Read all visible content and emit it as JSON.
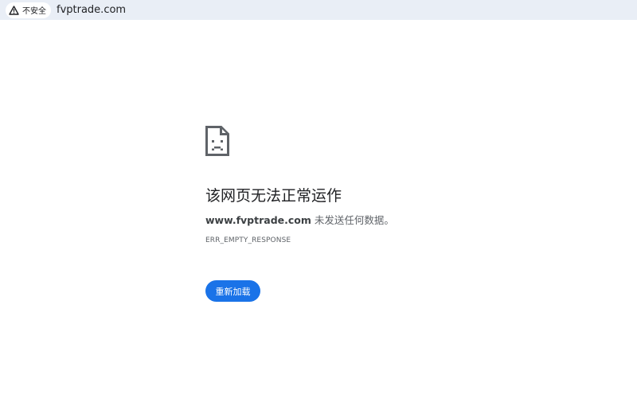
{
  "address_bar": {
    "security_label": "不安全",
    "security_icon": "warning-triangle-icon",
    "url": "fvptrade.com"
  },
  "error": {
    "icon": "sad-file-icon",
    "heading": "该网页无法正常运作",
    "host": "www.fvptrade.com",
    "message": " 未发送任何数据。",
    "code": "ERR_EMPTY_RESPONSE",
    "reload_label": "重新加载"
  },
  "colors": {
    "address_bar_bg": "#e9eef6",
    "button_blue": "#1a73e8",
    "text_primary": "#202124",
    "text_secondary": "#5f6368"
  }
}
